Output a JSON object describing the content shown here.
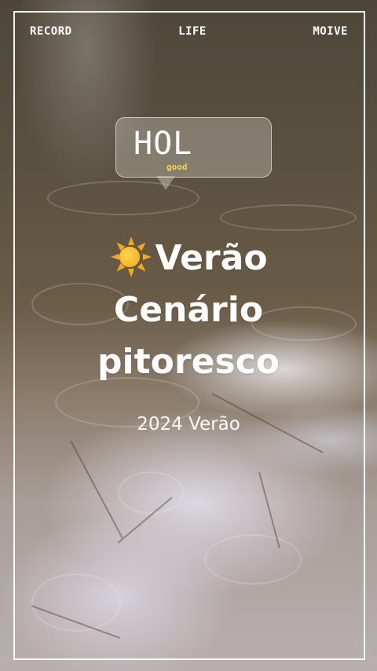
{
  "nav": {
    "left": "RECORD",
    "center": "LIFE",
    "right": "MOIVE"
  },
  "bubble": {
    "title": "HOL",
    "subtitle": "good"
  },
  "headline": {
    "icon": "sun-emoji",
    "line1": "Verão",
    "line2": "Cenário",
    "line3": "pitoresco"
  },
  "subtitle": "2024 Verão",
  "colors": {
    "frame": "#ffffff",
    "accent": "#f3d64a",
    "sun": "#f5a623"
  }
}
